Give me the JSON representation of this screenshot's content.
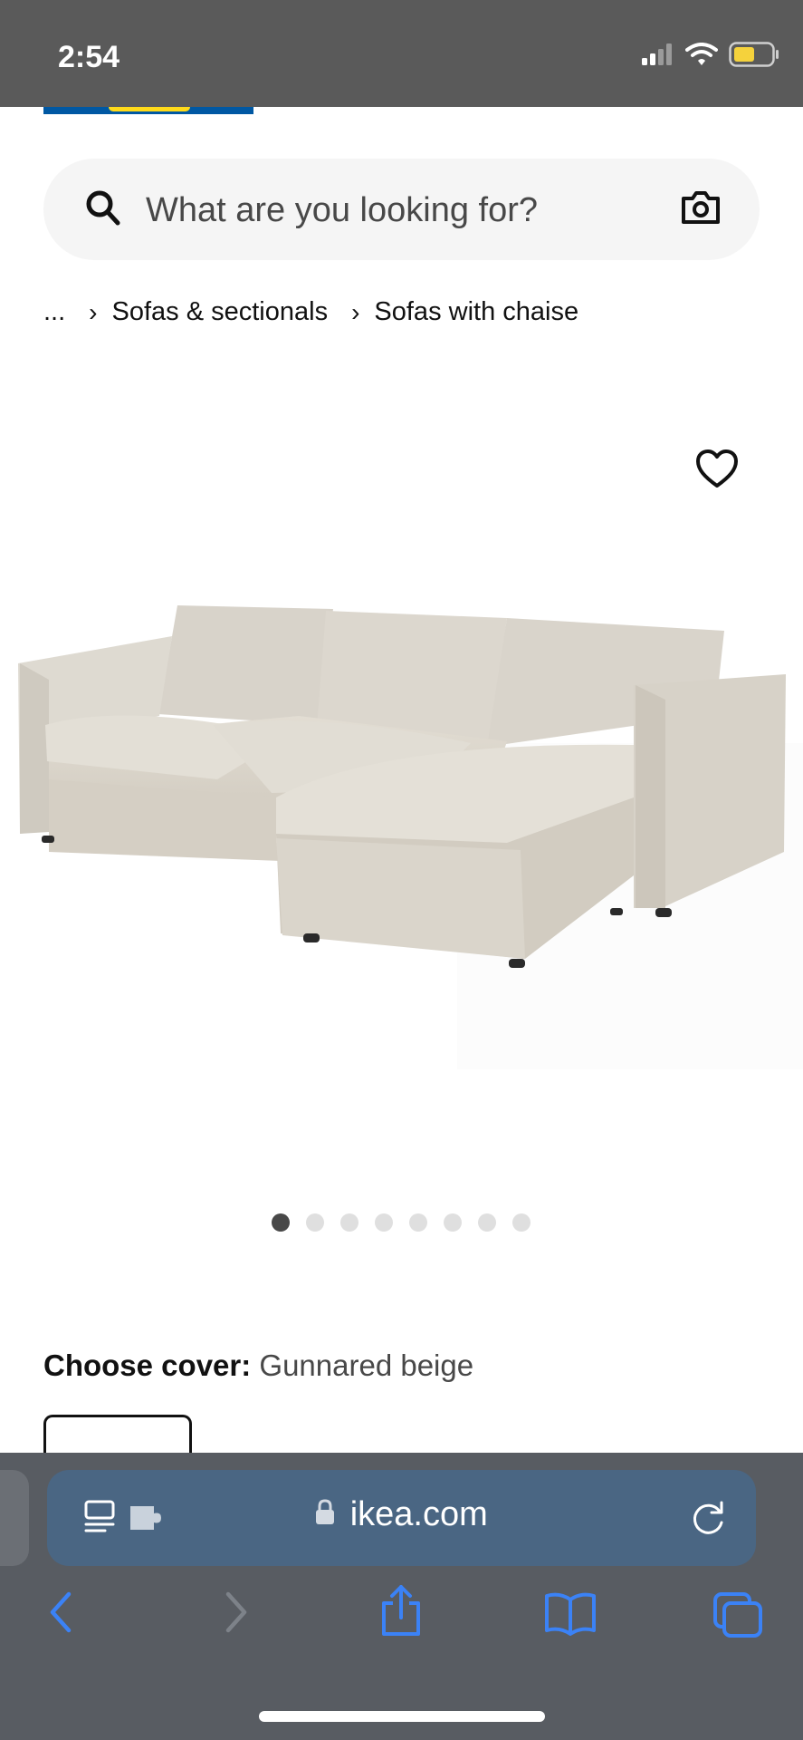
{
  "status_bar": {
    "time": "2:54",
    "icons": [
      "cellular-signal-icon",
      "wifi-icon",
      "battery-icon"
    ],
    "battery_color": "#f5d23c"
  },
  "brand": {
    "logo": "ikea-logo",
    "colors": {
      "blue": "#0058a3",
      "yellow": "#ffda1a"
    }
  },
  "search": {
    "placeholder": "What are you looking for?",
    "icons": [
      "search-icon",
      "camera-icon"
    ]
  },
  "breadcrumb": {
    "items": [
      "...",
      "Sofas & sectionals",
      "Sofas with chaise"
    ]
  },
  "product": {
    "image": "beige-sofa-with-chaise",
    "favorite_icon": "heart-icon",
    "carousel": {
      "total": 8,
      "active_index": 0
    },
    "cover": {
      "label": "Choose cover:",
      "value": "Gunnared beige"
    }
  },
  "browser": {
    "url": "ikea.com",
    "icons": [
      "reader-icon",
      "extension-icon",
      "lock-icon",
      "reload-icon"
    ],
    "toolbar": [
      "back-icon",
      "forward-icon",
      "share-icon",
      "bookmarks-icon",
      "tabs-icon"
    ],
    "accent_color": "#3b82f6"
  }
}
